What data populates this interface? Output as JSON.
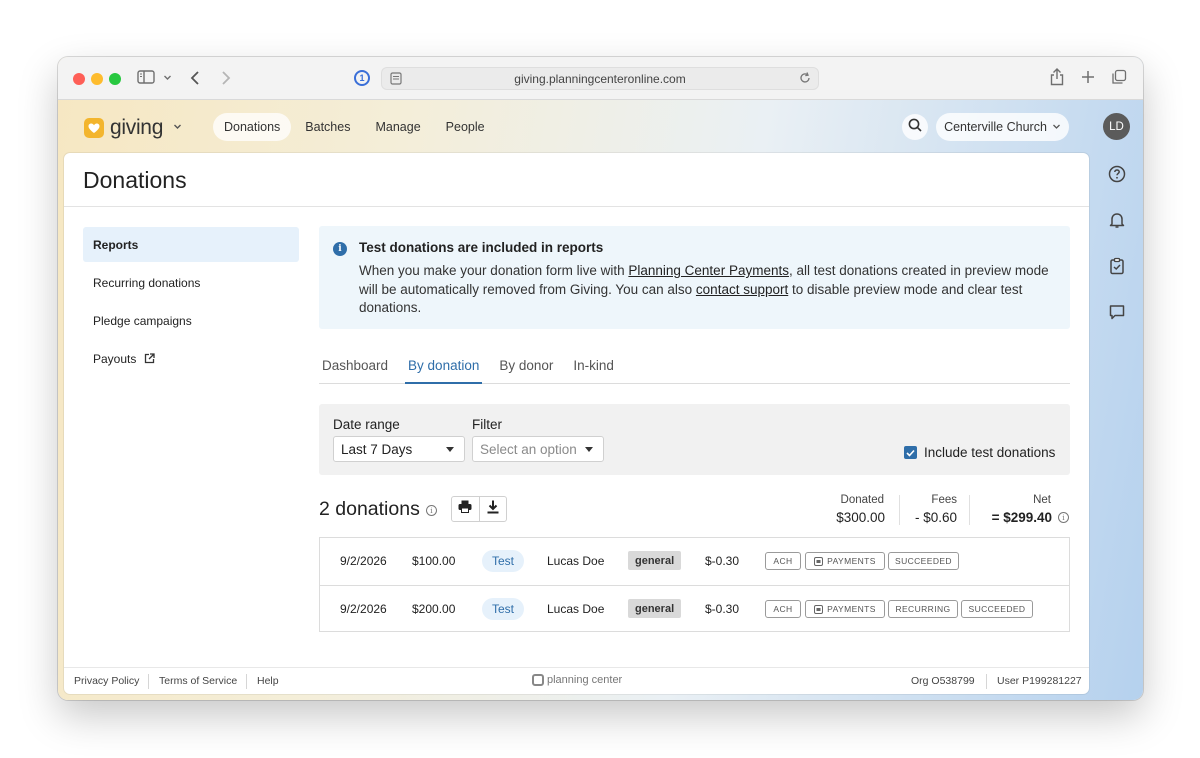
{
  "browser": {
    "url": "giving.planningcenteronline.com"
  },
  "app": {
    "logo_text": "giving",
    "nav": [
      "Donations",
      "Batches",
      "Manage",
      "People"
    ],
    "org_name": "Centerville Church",
    "avatar_initials": "LD"
  },
  "page": {
    "title": "Donations",
    "subnav": [
      "Reports",
      "Recurring donations",
      "Pledge campaigns",
      "Payouts"
    ]
  },
  "alert": {
    "title": "Test donations are included in reports",
    "body_1": "When you make your donation form live with ",
    "link_1": "Planning Center Payments",
    "body_2": ", all test donations created in preview mode will be automatically removed from Giving. You can also ",
    "link_2": "contact support",
    "body_3": " to disable preview mode and clear test donations."
  },
  "tabs": [
    "Dashboard",
    "By donation",
    "By donor",
    "In-kind"
  ],
  "filters": {
    "date_label": "Date range",
    "date_value": "Last 7 Days",
    "filter_label": "Filter",
    "filter_placeholder": "Select an option",
    "include_test_label": "Include test donations"
  },
  "summary": {
    "count_title": "2 donations",
    "donated_label": "Donated",
    "donated_value": "$300.00",
    "fees_label": "Fees",
    "fees_value": "- $0.60",
    "net_label": "Net",
    "net_value": "= $299.40"
  },
  "donations": [
    {
      "date": "9/2/2026",
      "amount": "$100.00",
      "badge": "Test",
      "donor": "Lucas Doe",
      "fund": "general",
      "fee": "$-0.30",
      "tags": [
        "ACH",
        "PAYMENTS",
        "SUCCEEDED"
      ]
    },
    {
      "date": "9/2/2026",
      "amount": "$200.00",
      "badge": "Test",
      "donor": "Lucas Doe",
      "fund": "general",
      "fee": "$-0.30",
      "tags": [
        "ACH",
        "PAYMENTS",
        "RECURRING",
        "SUCCEEDED"
      ]
    }
  ],
  "footer": {
    "privacy": "Privacy Policy",
    "terms": "Terms of Service",
    "help": "Help",
    "brand": "planning center",
    "org_id": "Org O538799",
    "user_id": "User P199281227"
  },
  "colors": {
    "accent": "#2f6ea9",
    "brand_yellow": "#f3b52d"
  }
}
